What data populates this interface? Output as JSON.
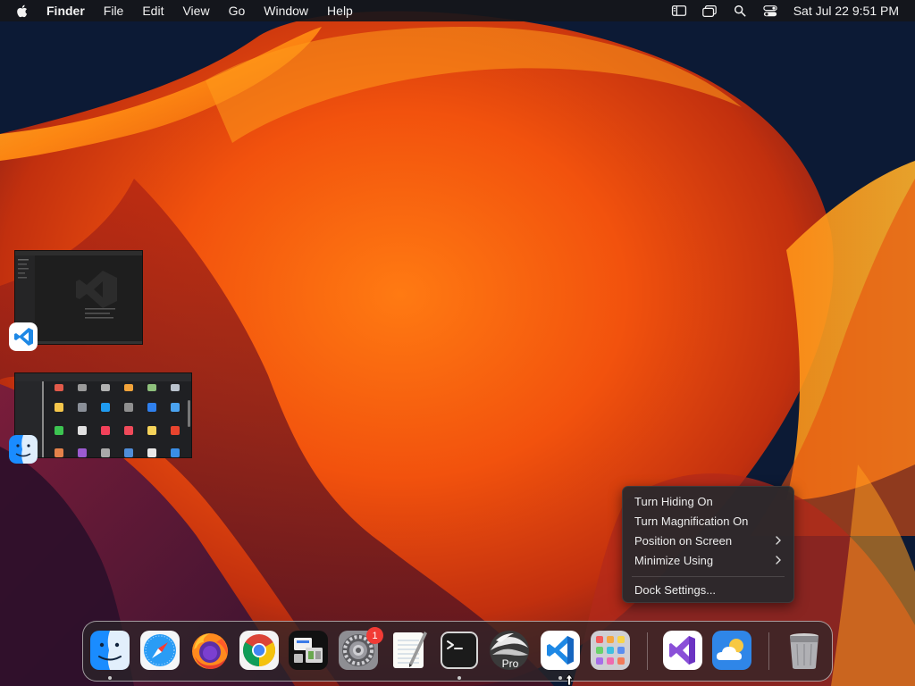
{
  "menubar": {
    "app_name": "Finder",
    "items": [
      "File",
      "Edit",
      "View",
      "Go",
      "Window",
      "Help"
    ],
    "status_icons": [
      "sidebar-icon",
      "window-overview-icon",
      "search-icon",
      "control-center-icon"
    ],
    "clock": "Sat Jul 22  9:51 PM"
  },
  "window_thumbnails": [
    {
      "app": "Visual Studio Code",
      "icon": "vscode-icon"
    },
    {
      "app": "Finder",
      "icon": "finder-icon"
    }
  ],
  "context_menu": {
    "items": [
      {
        "label": "Turn Hiding On",
        "submenu": false
      },
      {
        "label": "Turn Magnification On",
        "submenu": false
      },
      {
        "label": "Position on Screen",
        "submenu": true
      },
      {
        "label": "Minimize Using",
        "submenu": true
      },
      {
        "label": "Dock Settings...",
        "submenu": false
      }
    ]
  },
  "dock": {
    "apps": [
      {
        "name": "Finder",
        "icon": "finder-icon",
        "running": true
      },
      {
        "name": "Safari",
        "icon": "safari-icon",
        "running": false
      },
      {
        "name": "Firefox",
        "icon": "firefox-icon",
        "running": false
      },
      {
        "name": "Google Chrome",
        "icon": "chrome-icon",
        "running": false
      },
      {
        "name": "Screen Utility",
        "icon": "screen-utility-icon",
        "running": false
      },
      {
        "name": "System Settings",
        "icon": "gear-icon",
        "running": false,
        "badge": "1"
      },
      {
        "name": "TextEdit",
        "icon": "textedit-icon",
        "running": false
      },
      {
        "name": "Terminal",
        "icon": "terminal-icon",
        "running": true
      },
      {
        "name": "Pro App",
        "icon": "pro-app-icon",
        "running": false,
        "label": "Pro"
      },
      {
        "name": "Visual Studio Code",
        "icon": "vscode-icon",
        "running": true
      },
      {
        "name": "Launchpad",
        "icon": "launchpad-icon",
        "running": false
      },
      {
        "name": "Visual Studio",
        "icon": "visual-studio-icon",
        "running": false
      },
      {
        "name": "Weather",
        "icon": "weather-icon",
        "running": false
      },
      {
        "name": "Trash",
        "icon": "trash-icon",
        "running": false
      }
    ]
  },
  "colors": {
    "accent_orange": "#f26a10",
    "badge_red": "#f23b35",
    "vscode_blue": "#1e88e5"
  }
}
